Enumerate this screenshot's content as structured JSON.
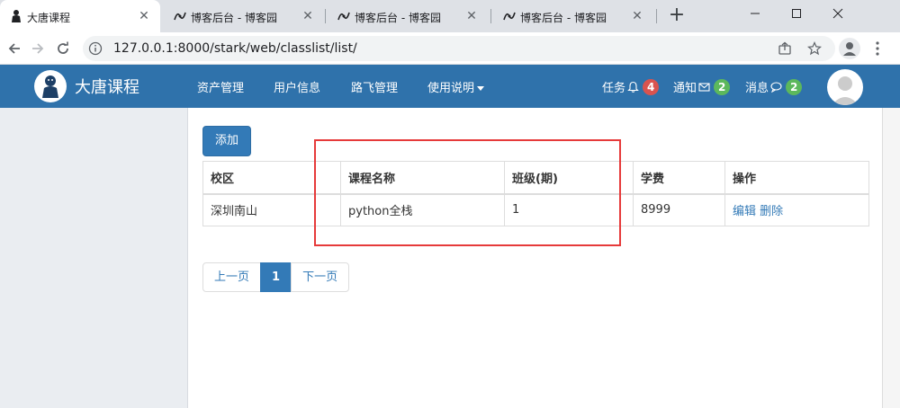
{
  "browser": {
    "tabs": [
      {
        "title": "大唐课程",
        "active": true
      },
      {
        "title": "博客后台 - 博客园",
        "active": false
      },
      {
        "title": "博客后台 - 博客园",
        "active": false
      },
      {
        "title": "博客后台 - 博客园",
        "active": false
      }
    ],
    "new_tab": "+",
    "url": "127.0.0.1:8000/stark/web/classlist/list/"
  },
  "site": {
    "brand": "大唐课程",
    "menu": [
      "资产管理",
      "用户信息",
      "路飞管理",
      "使用说明"
    ],
    "notifications": [
      {
        "label": "任务",
        "icon": "bell-icon",
        "count": "4",
        "color": "#d9534f"
      },
      {
        "label": "通知",
        "icon": "envelope-icon",
        "count": "2",
        "color": "#5cb85c"
      },
      {
        "label": "消息",
        "icon": "comment-icon",
        "count": "2",
        "color": "#5cb85c"
      }
    ],
    "navbar_color": "#2f72ab"
  },
  "main": {
    "add_label": "添加",
    "table": {
      "headers": [
        "校区",
        "课程名称",
        "班级(期)",
        "学费",
        "操作"
      ],
      "rows": [
        {
          "campus": "深圳南山",
          "course": "python全栈",
          "semester": "1",
          "price": "8999",
          "edit": "编辑",
          "delete": "删除"
        }
      ]
    },
    "pagination": {
      "prev": "上一页",
      "current": "1",
      "next": "下一页"
    },
    "highlight_color": "#e63a3a"
  }
}
